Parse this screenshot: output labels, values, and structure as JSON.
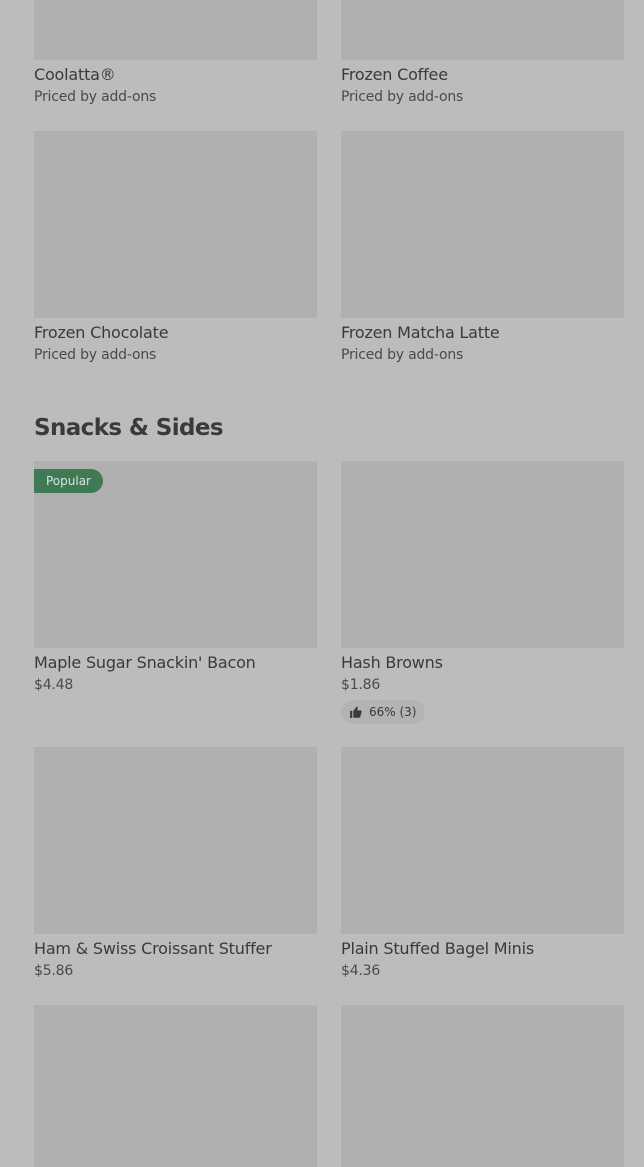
{
  "items": {
    "coolatta": {
      "name": "Coolatta®",
      "price": "Priced by add-ons"
    },
    "frozen_coffee": {
      "name": "Frozen Coffee",
      "price": "Priced by add-ons"
    },
    "frozen_chocolate": {
      "name": "Frozen Chocolate",
      "price": "Priced by add-ons"
    },
    "frozen_matcha_latte": {
      "name": "Frozen Matcha Latte",
      "price": "Priced by add-ons"
    },
    "maple_bacon": {
      "name": "Maple Sugar Snackin' Bacon",
      "price": "$4.48",
      "badge": "Popular"
    },
    "hash_browns": {
      "name": "Hash Browns",
      "price": "$1.86",
      "rating": "66% (3)"
    },
    "ham_swiss": {
      "name": "Ham & Swiss Croissant Stuffer",
      "price": "$5.86"
    },
    "bagel_minis": {
      "name": "Plain Stuffed Bagel Minis",
      "price": "$4.36"
    }
  },
  "sections": {
    "snacks_sides": {
      "title": "Snacks & Sides"
    }
  },
  "icons": {
    "thumbs_up": "thumbs-up-icon"
  },
  "colors": {
    "overlay_bg": "#bcbcbc",
    "image_placeholder": "#b0b0b0",
    "popular_badge": "#3f7a54"
  }
}
